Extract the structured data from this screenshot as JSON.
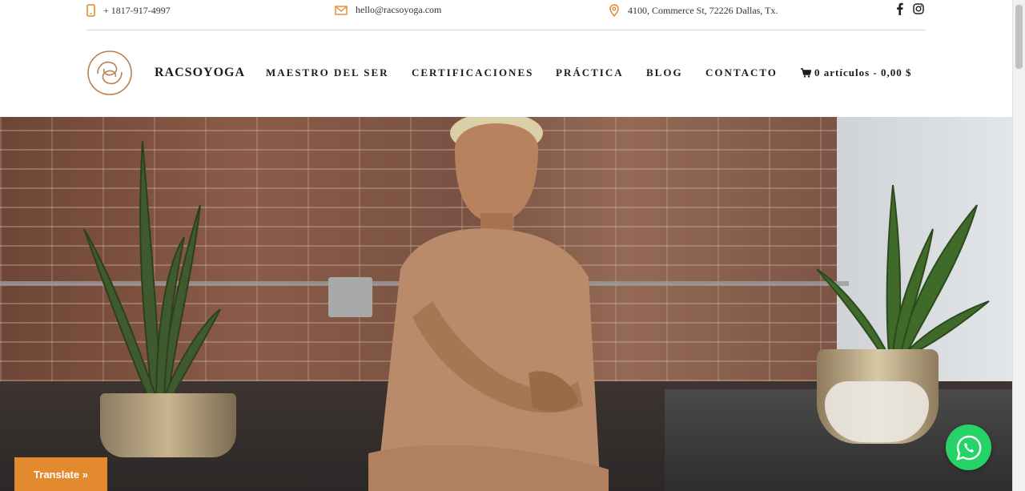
{
  "topbar": {
    "phone": "+ 1817-917-4997",
    "email": "hello@racsoyoga.com",
    "address": "4100, Commerce St, 72226 Dallas, Tx.",
    "social": [
      {
        "icon": "facebook-icon"
      },
      {
        "icon": "instagram-icon"
      }
    ]
  },
  "header": {
    "brand": "RACSOYOGA",
    "nav": [
      "MAESTRO DEL SER",
      "CERTIFICACIONES",
      "PRÁCTICA",
      "BLOG",
      "CONTACTO"
    ],
    "cart_label": "0 artículos - 0,00 $"
  },
  "floating": {
    "translate_label": "Translate »",
    "whatsapp_icon": "whatsapp-icon"
  },
  "colors": {
    "accent": "#e38a2e",
    "logo": "#b9804f",
    "whatsapp": "#25d366"
  }
}
